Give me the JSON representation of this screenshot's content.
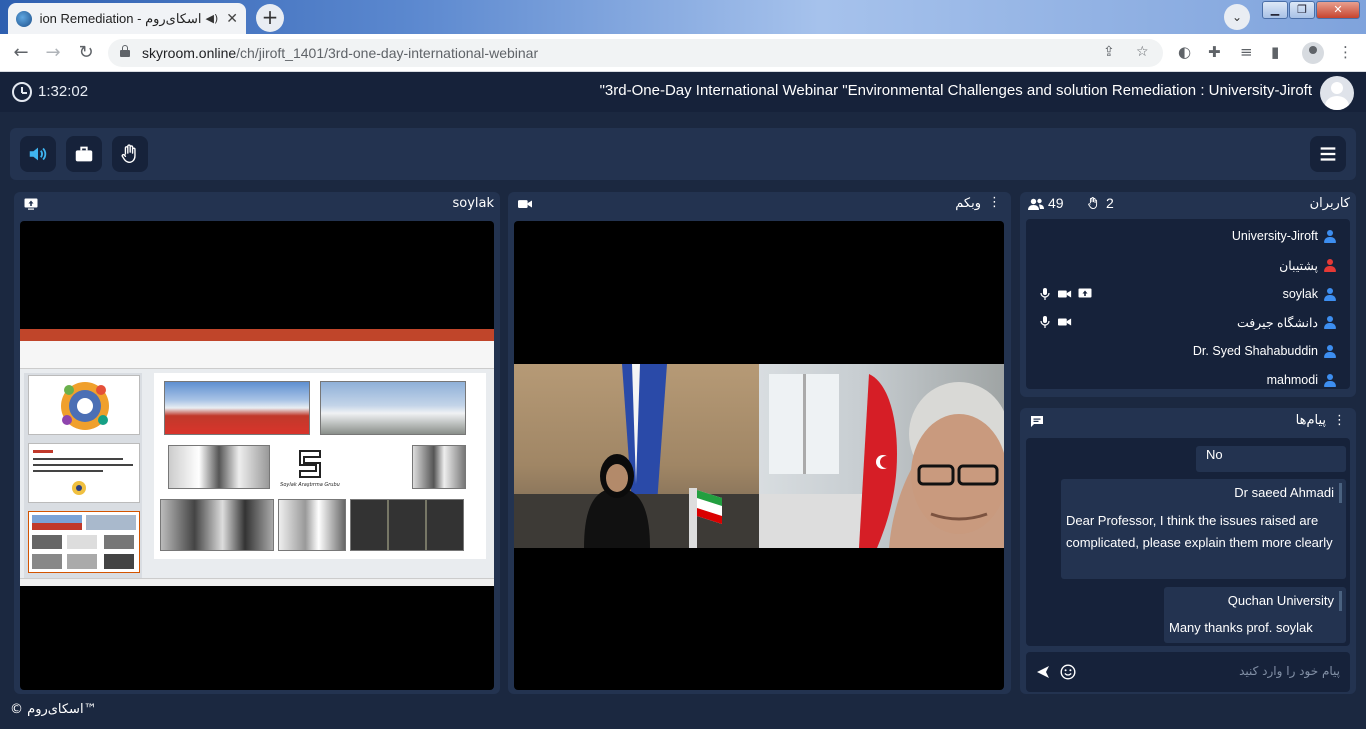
{
  "browser": {
    "tab_title": "اسکای‌روم - Solution Remediation",
    "url_host": "skyroom.online",
    "url_path": "/ch/jiroft_1401/3rd-one-day-international-webinar",
    "window_buttons": {
      "minimize": "▁",
      "maximize": "❐",
      "close": "✕"
    }
  },
  "header": {
    "timer": "1:32:02",
    "room_title": "\"3rd-One-Day International Webinar \"Environmental Challenges and solution Remediation : University-Jiroft"
  },
  "controls": {
    "icons": [
      "speaker-icon",
      "briefcase-icon",
      "raise-hand-icon",
      "menu-icon"
    ]
  },
  "panels": {
    "screen_share": {
      "title": "soylak"
    },
    "webcam": {
      "title": "وبکم"
    },
    "users": {
      "title": "کاربران",
      "online_count": "49",
      "hands_count": "2",
      "list": [
        {
          "name": "University-Jiroft",
          "color": "#3d8ef0"
        },
        {
          "name": "پشتیبان",
          "color": "#e53935"
        },
        {
          "name": "soylak",
          "color": "#3d8ef0"
        },
        {
          "name": "دانشگاه جیرفت",
          "color": "#3d8ef0"
        },
        {
          "name": "Dr. Syed Shahabuddin",
          "color": "#3d8ef0"
        },
        {
          "name": "mahmodi",
          "color": "#3d8ef0"
        }
      ]
    },
    "chat": {
      "title": "پیام‌ها",
      "messages": [
        {
          "text": "No"
        },
        {
          "sender": "Dr saeed Ahmadi",
          "line1": "Dear Professor, I think the issues raised are",
          "line2": "complicated, please explain them more clearly"
        },
        {
          "sender": "Quchan University",
          "text": "Many thanks prof. soylak"
        }
      ],
      "input_placeholder": "پیام خود را وارد کنید"
    }
  },
  "slide": {
    "logo_text": "Soylak Araştırma Grubu"
  },
  "footer": {
    "brand": "© اسکای‌روم™"
  },
  "colors": {
    "bg": "#1b2840",
    "panel": "#233350",
    "dark": "#16223a",
    "accent": "#3fb5f0",
    "red": "#e53935"
  }
}
